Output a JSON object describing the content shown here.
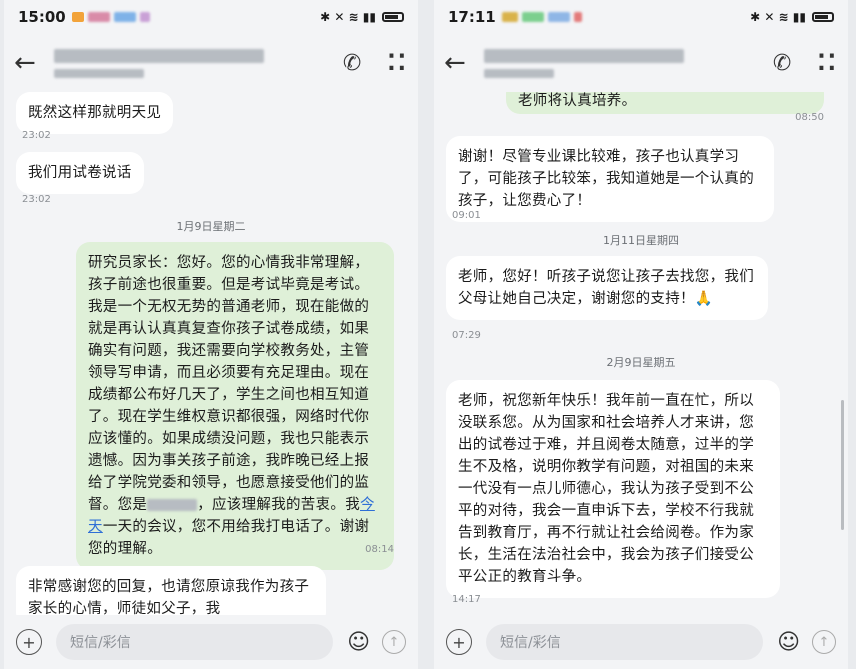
{
  "left": {
    "status": {
      "time": "15:00"
    },
    "messages": {
      "m1": "既然这样那就明天见",
      "t1": "23:02",
      "m2": "我们用试卷说话",
      "t2": "23:02",
      "day1": "1月9日星期二",
      "m3_part1": "研究员家长：您好。您的心情我非常理解，孩子前途也很重要。但是考试毕竟是考试。我是一个无权无势的普通老师，现在能做的就是再认认真真复查你孩子试卷成绩，如果确实有问题，我还需要向学校教务处，主管领导写申请，而且必须要有充足理由。现在成绩都公布好几天了，学生之间也相互知道了。现在学生维权意识都很强，网络时代你应该懂的。如果成绩没问题，我也只能表示遗憾。因为事关孩子前途，我昨晚已经上报给了学院党委和领导，也愿意接受他们的监督。您是",
      "m3_part2": "，应该理解我的苦衷。我",
      "m3_link": "今天",
      "m3_part3": "一天的会议，您不用给我打电话了。谢谢您的理解。",
      "t3": "08:14",
      "m4": "非常感谢您的回复，也请您原谅我作为孩子家长的心情，师徒如父子，我"
    },
    "input": {
      "placeholder": "短信/彩信"
    }
  },
  "right": {
    "status": {
      "time": "17:11"
    },
    "messages": {
      "m0": "老师将认真培养。",
      "t0": "08:50",
      "m1": "谢谢！尽管专业课比较难，孩子也认真学习了，可能孩子比较笨，我知道她是一个认真的孩子，让您费心了！",
      "t1": "09:01",
      "day1": "1月11日星期四",
      "m2": "老师，您好！听孩子说您让孩子去找您，我们父母让她自己决定，谢谢您的支持！🙏",
      "t2": "07:29",
      "day2": "2月9日星期五",
      "m3": "老师，祝您新年快乐！我年前一直在忙，所以没联系您。从为国家和社会培养人才来讲，您出的试卷过于难，并且阅卷太随意，过半的学生不及格，说明你教学有问题，对祖国的未来一代没有一点儿师德心，我认为孩子受到不公平的对待，我会一直申诉下去，学校不行我就告到教育厅，再不行就让社会给阅卷。作为家长，生活在法治社会中，我会为孩子们接受公平公正的教育斗争。",
      "t3": "14:17"
    },
    "input": {
      "placeholder": "短信/彩信"
    }
  },
  "icons": {
    "back": "←",
    "phone": "✆",
    "more": "⁚⁚",
    "add": "+",
    "emoji": "☺",
    "send": "↑",
    "net": "✱ ✕ ≋ ▮▮"
  },
  "colors": {
    "incoming": "#ffffff",
    "outgoing": "#dff0d8",
    "link": "#2f6fd6",
    "background": "#f3f4f6"
  }
}
